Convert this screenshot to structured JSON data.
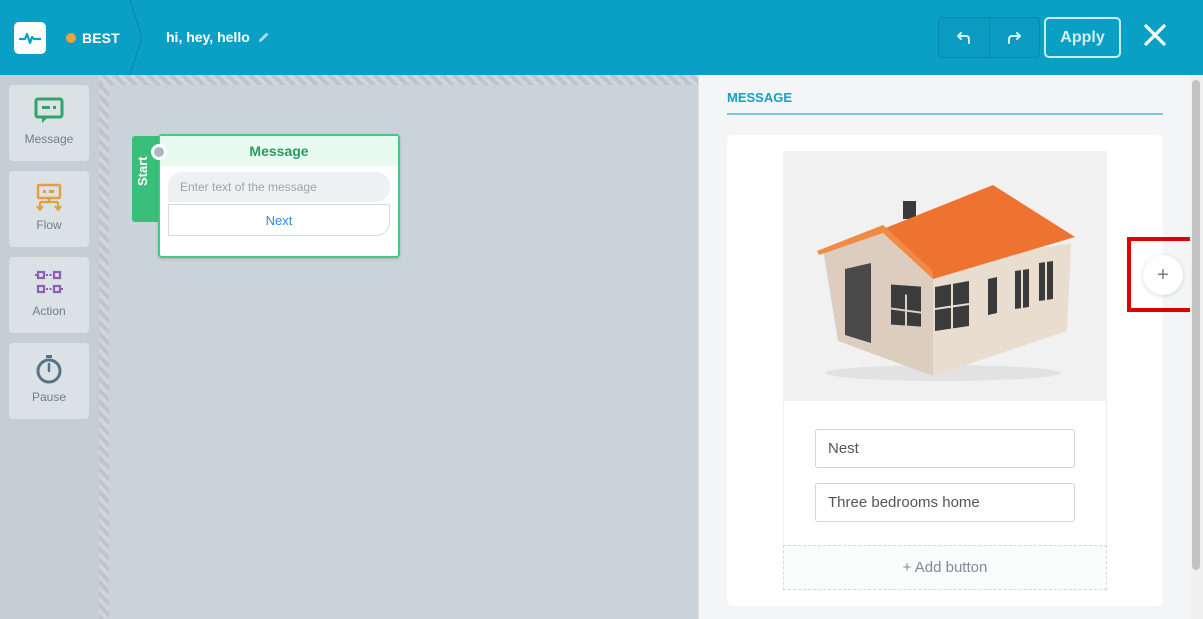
{
  "header": {
    "bot_name": "BEST",
    "status_color": "#f7a135",
    "flow_name": "hi, hey, hello",
    "apply_label": "Apply",
    "brand_color": "#0aa0c6"
  },
  "toolbox": {
    "items": [
      {
        "label": "Message",
        "icon": "message-icon",
        "color": "#2fa36b"
      },
      {
        "label": "Flow",
        "icon": "flow-icon",
        "color": "#e3a042"
      },
      {
        "label": "Action",
        "icon": "action-icon",
        "color": "#8d5fb1"
      },
      {
        "label": "Pause",
        "icon": "stopwatch-icon",
        "color": "#5a7484"
      }
    ]
  },
  "canvas": {
    "start_label": "Start",
    "node": {
      "title": "Message",
      "text_placeholder": "Enter text of the message",
      "button_label": "Next"
    }
  },
  "panel": {
    "title": "MESSAGE",
    "gallery": {
      "image": "house-image",
      "title_value": "Nest",
      "subtitle_value": "Three bedrooms home",
      "add_button_label": "+ Add button",
      "add_card_label": "+"
    }
  }
}
